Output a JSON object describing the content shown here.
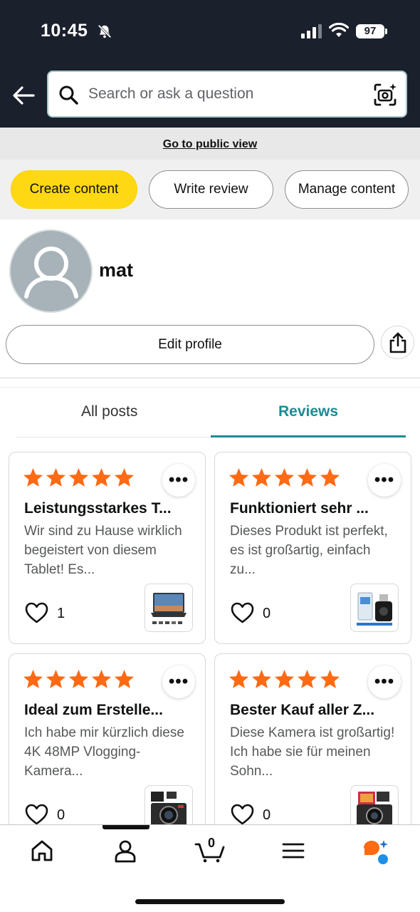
{
  "status_bar": {
    "time": "10:45",
    "battery": "97"
  },
  "header": {
    "search_placeholder": "Search or ask a question"
  },
  "public_view_link": "Go to public view",
  "actions": {
    "create": "Create content",
    "write": "Write review",
    "manage": "Manage content"
  },
  "profile": {
    "name": "mat",
    "edit_label": "Edit profile"
  },
  "tabs": {
    "all": "All posts",
    "reviews": "Reviews",
    "active": "Reviews"
  },
  "reviews": [
    {
      "rating": 5,
      "title": "Leistungsstarkes T...",
      "body": "Wir sind zu Hause wirklich begeistert von diesem Tablet! Es...",
      "likes": "1"
    },
    {
      "rating": 5,
      "title": "Funktioniert sehr ...",
      "body": "Dieses Produkt ist perfekt, es ist großartig, einfach zu...",
      "likes": "0"
    },
    {
      "rating": 5,
      "title": "Ideal zum Erstelle...",
      "body": "Ich habe mir kürzlich diese 4K 48MP Vlogging-Kamera...",
      "likes": "0"
    },
    {
      "rating": 5,
      "title": "Bester Kauf aller Z...",
      "body": "Diese Kamera ist großartig! Ich habe sie für meinen Sohn...",
      "likes": "0"
    }
  ],
  "bottom_nav": {
    "cart_count": "0",
    "items": [
      "home-icon",
      "profile-icon",
      "cart-icon",
      "menu-icon",
      "ai-assistant-icon"
    ]
  },
  "colors": {
    "header_bg": "#1a202c",
    "accent": "#1d8b95",
    "star": "#ff6a13",
    "primary_button": "#ffd814"
  }
}
